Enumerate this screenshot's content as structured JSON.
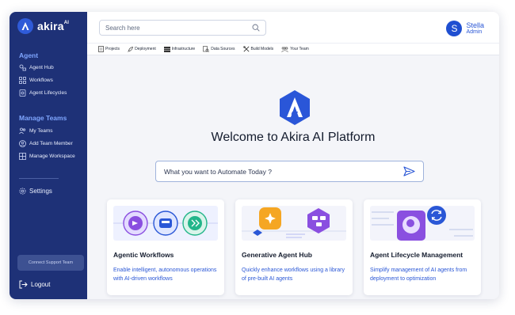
{
  "brand": {
    "name": "akira",
    "superscript": "AI"
  },
  "sidebar": {
    "agent_section": "Agent",
    "agent_items": [
      {
        "label": "Agent Hub",
        "icon": "agent-hub-icon"
      },
      {
        "label": "Workflows",
        "icon": "workflows-icon"
      },
      {
        "label": "Agent Lifecycles",
        "icon": "lifecycle-icon"
      }
    ],
    "teams_section": "Manage Teams",
    "team_items": [
      {
        "label": "My Teams",
        "icon": "teams-icon"
      },
      {
        "label": "Add Team Member",
        "icon": "add-member-icon"
      },
      {
        "label": "Manage Workspace",
        "icon": "workspace-icon"
      }
    ],
    "settings": "Settings",
    "support_button": "Connect Support Team",
    "logout": "Logout"
  },
  "topbar": {
    "search_placeholder": "Search here",
    "user": {
      "initial": "S",
      "name": "Stella",
      "role": "Admin"
    }
  },
  "subnav": [
    {
      "label": "Projects",
      "icon": "document-icon"
    },
    {
      "label": "Deployment",
      "icon": "rocket-icon"
    },
    {
      "label": "Infrastructure",
      "icon": "server-icon"
    },
    {
      "label": "Data Sources",
      "icon": "data-icon"
    },
    {
      "label": "Build Models",
      "icon": "tools-icon"
    },
    {
      "label": "Your Team",
      "icon": "team-icon"
    }
  ],
  "main": {
    "welcome": "Welcome to Akira AI Platform",
    "prompt_placeholder": "What you want to Automate Today ?",
    "cards": [
      {
        "title": "Agentic Workflows",
        "description": "Enable intelligent, autonomous operations with AI-driven workflows"
      },
      {
        "title": "Generative Agent Hub",
        "description": "Quickly enhance workflows using a library of pre-built AI agents"
      },
      {
        "title": "Agent Lifecycle Management",
        "description": "Simplify management of AI agents from deployment to optimization"
      }
    ]
  },
  "colors": {
    "sidebar": "#1e3177",
    "accent": "#2a57d6",
    "section": "#7fa6ff",
    "purple": "#8a4fe0",
    "orange": "#f5a623",
    "green": "#22b58a"
  }
}
